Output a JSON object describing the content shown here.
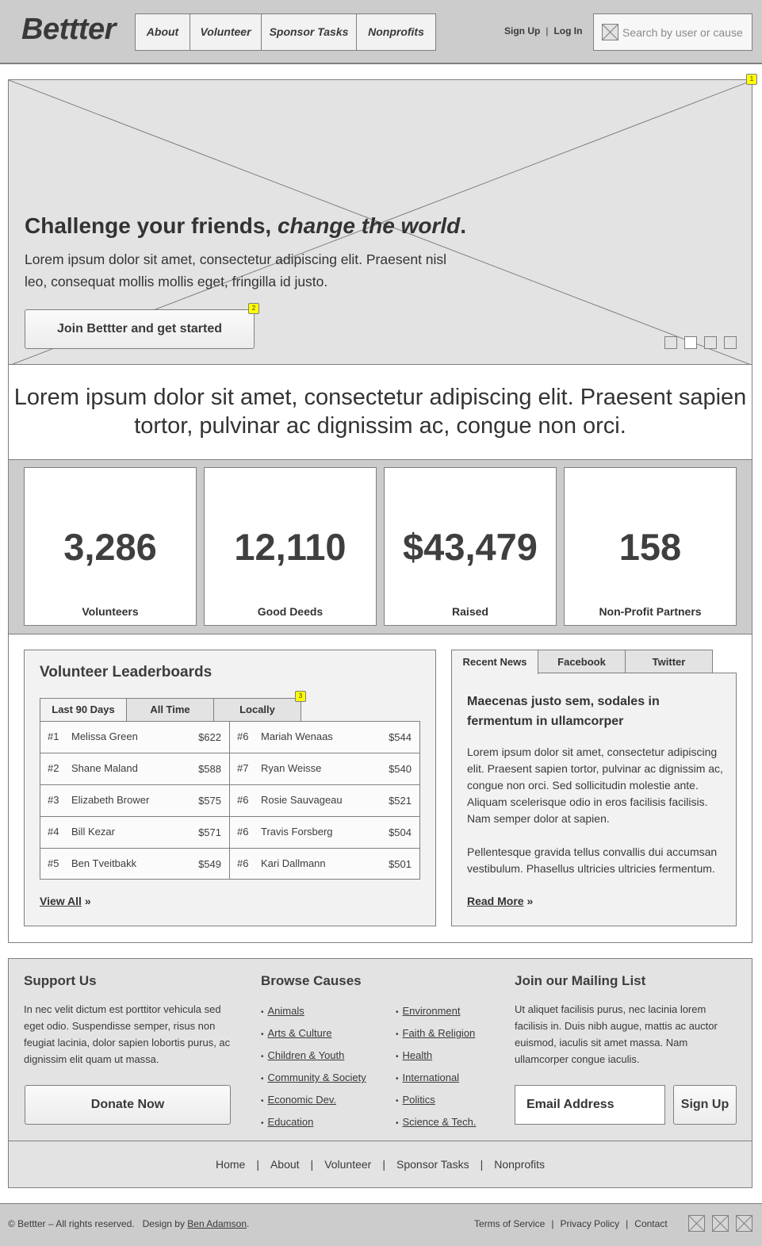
{
  "header": {
    "logo": "Bettter",
    "nav": [
      {
        "label": "About"
      },
      {
        "label": "Volunteer"
      },
      {
        "label": "Sponsor Tasks"
      },
      {
        "label": "Nonprofits"
      }
    ],
    "sign_up": "Sign Up",
    "separator": "|",
    "log_in": "Log In",
    "search": {
      "placeholder": "Search by user or cause",
      "value": "",
      "icon": "image-placeholder-icon"
    }
  },
  "hero": {
    "title_regular": "Challenge your friends, ",
    "title_italic": "change the world",
    "title_end": ".",
    "text": "Lorem ipsum dolor sit amet, consectetur adipiscing elit. Praesent nisl leo, consequat mollis mollis eget, fringilla id justo.",
    "cta": "Join Bettter and get started",
    "annotations": [
      "1",
      "2"
    ],
    "slides": {
      "count": 4,
      "active": 2
    }
  },
  "tagline": "Lorem ipsum dolor sit amet, consectetur adipiscing elit. Praesent sapien tortor, pulvinar ac dignissim ac, congue non orci.",
  "stats": [
    {
      "value": "3,286",
      "label": "Volunteers"
    },
    {
      "value": "12,110",
      "label": "Good Deeds"
    },
    {
      "value": "$43,479",
      "label": "Raised"
    },
    {
      "value": "158",
      "label": "Non-Profit Partners"
    }
  ],
  "leaderboard": {
    "title": "Volunteer Leaderboards",
    "annotation": "3",
    "tabs": [
      {
        "label": "Last 90 Days",
        "active": true
      },
      {
        "label": "All Time",
        "active": false
      },
      {
        "label": "Locally",
        "active": false
      }
    ],
    "columns": [
      [
        {
          "rank": "#1",
          "name": "Melissa Green",
          "amount": "$622"
        },
        {
          "rank": "#2",
          "name": "Shane Maland",
          "amount": "$588"
        },
        {
          "rank": "#3",
          "name": "Elizabeth Brower",
          "amount": "$575"
        },
        {
          "rank": "#4",
          "name": "Bill Kezar",
          "amount": "$571"
        },
        {
          "rank": "#5",
          "name": "Ben Tveitbakk",
          "amount": "$549"
        }
      ],
      [
        {
          "rank": "#6",
          "name": "Mariah Wenaas",
          "amount": "$544"
        },
        {
          "rank": "#7",
          "name": "Ryan Weisse",
          "amount": "$540"
        },
        {
          "rank": "#6",
          "name": "Rosie Sauvageau",
          "amount": "$521"
        },
        {
          "rank": "#6",
          "name": "Travis Forsberg",
          "amount": "$504"
        },
        {
          "rank": "#6",
          "name": "Kari Dallmann",
          "amount": "$501"
        }
      ]
    ],
    "view_all": "View All",
    "raquo": "»"
  },
  "news": {
    "tabs": [
      {
        "label": "Recent News",
        "active": true
      },
      {
        "label": "Facebook",
        "active": false
      },
      {
        "label": "Twitter",
        "active": false
      }
    ],
    "headline": "Maecenas justo sem, sodales in fermentum in ullamcorper",
    "paragraphs": [
      "Lorem ipsum dolor sit amet, consectetur adipiscing elit. Praesent sapien tortor, pulvinar ac dignissim ac, congue non orci. Sed sollicitudin molestie ante. Aliquam scelerisque odio in eros facilisis facilisis. Nam semper dolor at sapien.",
      "Pellentesque gravida tellus convallis dui accumsan vestibulum. Phasellus ultricies ultricies fermentum."
    ],
    "read_more": "Read More",
    "raquo": "»"
  },
  "footer": {
    "support": {
      "title": "Support Us",
      "text": "In nec velit dictum est porttitor vehicula sed eget odio. Suspendisse semper, risus non feugiat lacinia, dolor sapien lobortis purus, ac dignissim elit quam ut massa.",
      "button": "Donate Now"
    },
    "causes": {
      "title": "Browse Causes",
      "left": [
        "Animals",
        "Arts & Culture",
        "Children & Youth",
        "Community & Society",
        "Economic Dev.",
        "Education"
      ],
      "right": [
        "Environment",
        "Faith & Religion",
        "Health",
        "International",
        "Politics",
        "Science & Tech."
      ]
    },
    "mailing": {
      "title": "Join our Mailing List",
      "text": "Ut aliquet facilisis purus, nec lacinia lorem facilisis in. Duis nibh augue, mattis ac auctor euismod, iaculis sit amet massa. Nam ullamcorper congue iaculis.",
      "email_placeholder": "Email Address",
      "email_value": "",
      "button": "Sign Up"
    },
    "nav": [
      "Home",
      "About",
      "Volunteer",
      "Sponsor Tasks",
      "Nonprofits"
    ],
    "separator": "|"
  },
  "bottom": {
    "copyright": "© Bettter – All rights reserved.   Design by ",
    "designer": "Ben Adamson",
    "period": ".",
    "links": [
      "Terms of Service",
      "Privacy Policy",
      "Contact"
    ],
    "separator": "|",
    "social_icons": [
      "social-icon-placeholder",
      "social-icon-placeholder",
      "social-icon-placeholder"
    ]
  },
  "colors": {
    "header_bg": "#cccccc",
    "panel_bg": "#e3e3e3",
    "card_bg": "#f2f2f2",
    "border": "#7f7f7f",
    "text": "#3a3a3a",
    "annotation": "#ffff00"
  }
}
